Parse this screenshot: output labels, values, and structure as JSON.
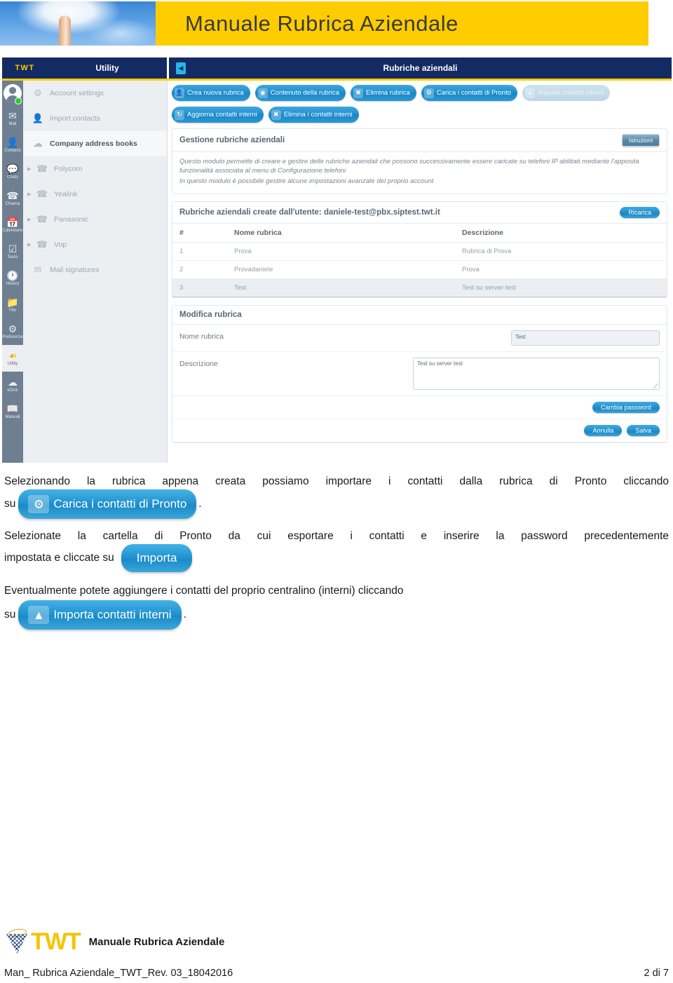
{
  "banner": {
    "title": "Manuale Rubrica Aziendale"
  },
  "app": {
    "topbar": {
      "logo": "TWT",
      "section": "Utility",
      "collapse_icon": "chevron-left-icon",
      "title": "Rubriche aziendali"
    },
    "rail": [
      {
        "icon": "avatar-icon",
        "label": ""
      },
      {
        "icon": "envelope-icon",
        "label": "Mail"
      },
      {
        "icon": "person-icon",
        "label": "Contacts"
      },
      {
        "icon": "chat-icon",
        "label": "Chats"
      },
      {
        "icon": "phone-icon",
        "label": "Chiama"
      },
      {
        "icon": "calendar-icon",
        "label": "Calendario"
      },
      {
        "icon": "checklist-icon",
        "label": "Tasks"
      },
      {
        "icon": "clock-icon",
        "label": "History"
      },
      {
        "icon": "folder-icon",
        "label": "File"
      },
      {
        "icon": "gear-icon",
        "label": "Preferenze"
      },
      {
        "icon": "nodes-icon",
        "label": "Utility"
      },
      {
        "icon": "cloud-disk-icon",
        "label": "eDisk"
      },
      {
        "icon": "book-icon",
        "label": "Manuali"
      }
    ],
    "menu": [
      {
        "icon": "account-settings-icon",
        "label": "Account settings",
        "selected": false,
        "expandable": false
      },
      {
        "icon": "import-contacts-icon",
        "label": "Import contacts",
        "selected": false,
        "expandable": false
      },
      {
        "icon": "address-book-icon",
        "label": "Company address books",
        "selected": true,
        "expandable": false
      },
      {
        "icon": "phone-icon",
        "label": "Polycom",
        "selected": false,
        "expandable": true
      },
      {
        "icon": "phone-icon",
        "label": "Yealink",
        "selected": false,
        "expandable": true
      },
      {
        "icon": "phone-icon",
        "label": "Panasonic",
        "selected": false,
        "expandable": true
      },
      {
        "icon": "phone-icon",
        "label": "Vop",
        "selected": false,
        "expandable": true
      },
      {
        "icon": "mail-signature-icon",
        "label": "Mail signatures",
        "selected": false,
        "expandable": false
      }
    ],
    "toolbar": [
      {
        "label": "Crea nuova rubrica",
        "icon": "address-book-icon",
        "disabled": false
      },
      {
        "label": "Contenuto della rubrica",
        "icon": "eye-icon",
        "disabled": false
      },
      {
        "label": "Elimina rubrica",
        "icon": "x-circle-icon",
        "disabled": false
      },
      {
        "label": "Carica i contatti di Pronto",
        "icon": "database-import-icon",
        "disabled": false
      },
      {
        "label": "Importa contatti interni",
        "icon": "users-upload-icon",
        "disabled": true
      },
      {
        "label": "Aggiorna contatti interni",
        "icon": "users-refresh-icon",
        "disabled": false
      },
      {
        "label": "Elimina i contatti interni",
        "icon": "users-delete-icon",
        "disabled": false
      }
    ],
    "info_panel": {
      "title": "Gestione rubriche aziendali",
      "button": "Istruzioni",
      "lines": [
        "Questo modulo permette di creare e gestire delle rubriche aziendali che possono successivamente essere caricate su telefoni IP abilitati mediante l'apposita funzionalità associata al menu di Configurazione telefoni",
        "In questo modulo è possibile gestire alcune impostazioni avanzate del proprio account"
      ]
    },
    "list_panel": {
      "title": "Rubriche aziendali create dall'utente: daniele-test@pbx.siptest.twt.it",
      "reload_button": "Ricarica",
      "columns": [
        "#",
        "Nome rubrica",
        "Descrizione"
      ],
      "rows": [
        {
          "num": "1",
          "name": "Prova",
          "desc": "Rubrica di Prova",
          "selected": false
        },
        {
          "num": "2",
          "name": "Provadaniele",
          "desc": "Prova",
          "selected": false
        },
        {
          "num": "3",
          "name": "Test",
          "desc": "Test su server test",
          "selected": true
        }
      ]
    },
    "edit_panel": {
      "title": "Modifica rubrica",
      "name_label": "Nome rubrica",
      "name_value": "Test",
      "desc_label": "Descrizione",
      "desc_value": "Test su server test",
      "change_password_button": "Cambia password",
      "cancel_button": "Annulla",
      "save_button": "Salva"
    }
  },
  "doc": {
    "para1": "Selezionando la rubrica appena creata possiamo importare i contatti dalla rubrica di Pronto cliccando",
    "su1": "su",
    "btn1": {
      "label": "Carica i contatti di Pronto",
      "icon": "database-import-icon"
    },
    "period1": ".",
    "para2": "Selezionate la cartella di Pronto da cui esportare i contatti e inserire la password precedentemente",
    "su2": "impostata e cliccate su",
    "btn2": {
      "label": "Importa",
      "icon": ""
    },
    "para3": "Eventualmente potete aggiungere i contatti del proprio centralino (interni) cliccando",
    "su3": "su",
    "btn3": {
      "label": "Importa contatti interni",
      "icon": "users-upload-icon"
    },
    "period3": "."
  },
  "footer": {
    "logo_word": "TWT",
    "brand_text": "Manuale Rubrica Aziendale",
    "doc_ref": "Man_ Rubrica Aziendale_TWT_Rev. 03_18042016",
    "page": "2 di 7"
  },
  "colors": {
    "banner_yellow": "#ffcc00",
    "navy": "#142a63",
    "button_blue": "#1f8fce",
    "rail_gray": "#6e7f91"
  }
}
